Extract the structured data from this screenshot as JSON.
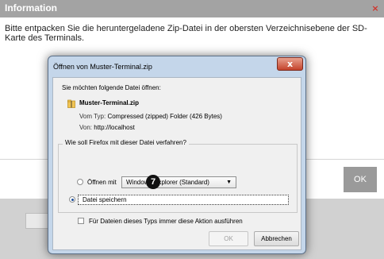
{
  "info_dialog": {
    "title": "Information",
    "message": "Bitte entpacken Sie die heruntergeladene Zip-Datei in der obersten Verzeichnisebene der SD-Karte des Terminals.",
    "close_glyph": "×",
    "ok_label": "OK"
  },
  "file_dialog": {
    "title": "Öffnen von Muster-Terminal.zip",
    "close_glyph": "x",
    "question": "Sie möchten folgende Datei öffnen:",
    "file_name": "Muster-Terminal.zip",
    "type_label": "Vom Typ:",
    "type_value": "Compressed (zipped) Folder (426 Bytes)",
    "from_label": "Von:",
    "from_value": "http://localhost",
    "group_legend": "Wie soll Firefox mit dieser Datei verfahren?",
    "open_with_label": "Öffnen mit",
    "open_with_selected": "Windows-Explorer (Standard)",
    "save_file_label": "Datei speichern",
    "always_label": "Für Dateien dieses Typs immer diese Aktion ausführen",
    "ok_label": "OK",
    "cancel_label": "Abbrechen",
    "selected_action": "save",
    "always_checked": false
  },
  "step_badge": "7",
  "icons": {
    "zip_icon": "zip-folder-icon",
    "dropdown_icon": "chevron-down-icon"
  },
  "colors": {
    "header_gray": "#a3a3a3",
    "close_red": "#d0342c",
    "dialog_frame": "#c4d6ea"
  }
}
